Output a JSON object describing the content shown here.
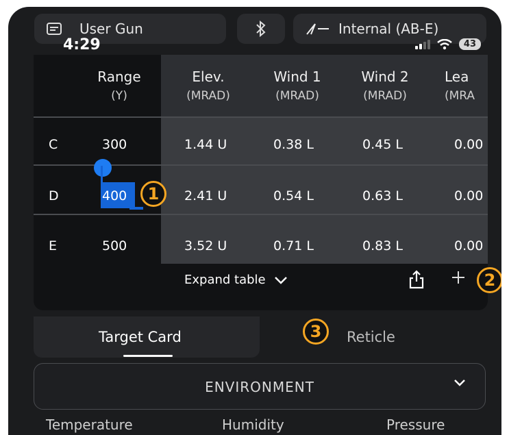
{
  "top_bar": {
    "gun_label": "User Gun",
    "device_label": "Internal (AB-E)",
    "time": "4:29",
    "battery": "43"
  },
  "table": {
    "headers": [
      {
        "title": "Range",
        "unit": "(Y)"
      },
      {
        "title": "Elev.",
        "unit": "(MRAD)"
      },
      {
        "title": "Wind 1",
        "unit": "(MRAD)"
      },
      {
        "title": "Wind 2",
        "unit": "(MRAD)"
      },
      {
        "title": "Lea",
        "unit": "(MRA"
      }
    ],
    "rows": [
      {
        "label": "C",
        "range": "300",
        "elev": "1.44 U",
        "wind1": "0.38 L",
        "wind2": "0.45 L",
        "lead": "0.00"
      },
      {
        "label": "D",
        "range": "400",
        "elev": "2.41 U",
        "wind1": "0.54 L",
        "wind2": "0.63 L",
        "lead": "0.00"
      },
      {
        "label": "E",
        "range": "500",
        "elev": "3.52 U",
        "wind1": "0.71 L",
        "wind2": "0.83 L",
        "lead": "0.00"
      }
    ],
    "expand_label": "Expand table"
  },
  "badges": [
    "1",
    "2",
    "3"
  ],
  "tabs": {
    "target_card": "Target Card",
    "reticle": "Reticle"
  },
  "environment": {
    "label": "ENVIRONMENT",
    "fields": [
      "Temperature",
      "Humidity",
      "Pressure"
    ]
  },
  "colors": {
    "accent": "#1e7cf2",
    "badge": "#f5a623"
  }
}
